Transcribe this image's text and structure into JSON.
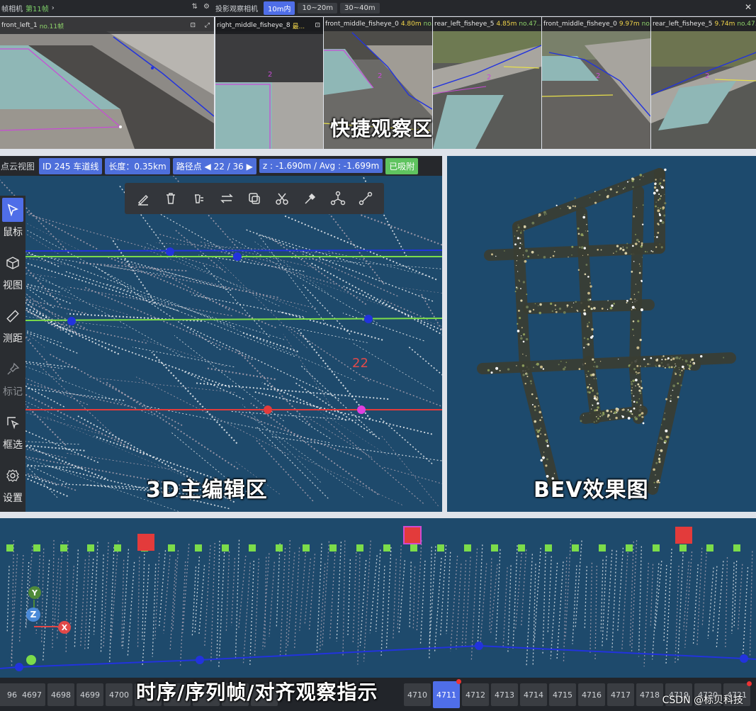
{
  "camera_header": {
    "left_title": "帧相机",
    "left_frame": "第11帧",
    "right_title": "投影观察相机",
    "range_options": [
      "10m内",
      "10~20m",
      "30~40m"
    ],
    "active_range": "10m内"
  },
  "cameras": [
    {
      "name": "front_left_1",
      "suffix": "no.11帧"
    },
    {
      "name": "right_middle_fisheye_8",
      "suffix": "最..."
    },
    {
      "name": "front_middle_fisheye_0",
      "dist": "4.80m",
      "suffix": "no.11"
    },
    {
      "name": "rear_left_fisheye_5",
      "dist": "4.85m",
      "suffix": "no.47..."
    },
    {
      "name": "front_middle_fisheye_0",
      "dist": "9.97m",
      "suffix": "no.47..."
    },
    {
      "name": "rear_left_fisheye_5",
      "dist": "9.74m",
      "suffix": "no.47..."
    }
  ],
  "banners": {
    "quick": "快捷观察区",
    "edit3d": "3D主编辑区",
    "bev": "BEV效果图",
    "timeline": "时序/序列帧/对齐观察指示"
  },
  "panel3d": {
    "title": "点云视图",
    "id_chip": "ID 245 车道线",
    "length_chip": "长度：0.35km",
    "path_label": "路径点",
    "path_value": "22 / 36",
    "z_chip": "z : -1.690m / Avg : -1.699m",
    "snap_chip": "已吸附",
    "point_label": "22"
  },
  "toolbar": [
    "pen-icon",
    "trash-icon",
    "delete-point-icon",
    "reverse-icon",
    "copy-icon",
    "scissors-icon",
    "dropper-icon",
    "nodes-icon",
    "connect-icon"
  ],
  "sidebar": [
    {
      "label": "鼠标",
      "icon": "cursor-icon"
    },
    {
      "label": "视图",
      "icon": "cube-icon"
    },
    {
      "label": "测距",
      "icon": "ruler-icon"
    },
    {
      "label": "标记",
      "icon": "pin-icon"
    },
    {
      "label": "框选",
      "icon": "box-select-icon"
    },
    {
      "label": "设置",
      "icon": "gear-icon"
    }
  ],
  "axes": {
    "y": "Y",
    "z": "Z",
    "x": "X"
  },
  "frames": [
    "96",
    "4697",
    "4698",
    "4699",
    "4700",
    "",
    "",
    "",
    "",
    "",
    "4710",
    "4711",
    "4712",
    "4713",
    "4714",
    "4715",
    "4716",
    "4717",
    "4718",
    "4719",
    "4720",
    "4721"
  ],
  "active_frame": "4711",
  "watermark": "CSDN @标贝科技",
  "colors": {
    "accent": "#4f6ee8",
    "lane_green": "#7cdc4a",
    "lane_blue": "#2233dd",
    "lane_red": "#e33b3b",
    "pointcloud_bg": "#1e4a6c"
  }
}
